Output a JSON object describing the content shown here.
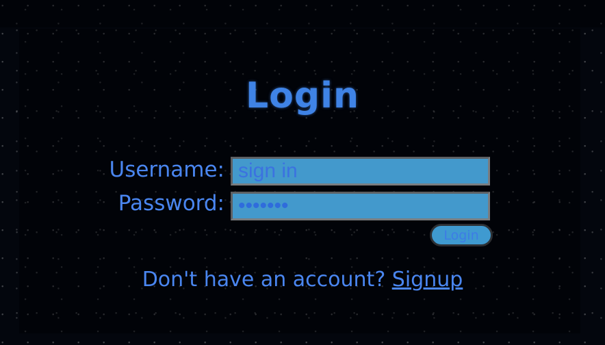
{
  "page": {
    "title": "Login"
  },
  "form": {
    "username_label": "Username:",
    "username_placeholder": "sign in",
    "username_value": "",
    "password_label": "Password:",
    "password_value": "•••••••",
    "login_button": "Login"
  },
  "footer": {
    "prompt": "Don't have an account?",
    "signup_link": "Signup"
  },
  "colors": {
    "text_accent": "#4a86f0",
    "field_background": "#4399cc",
    "page_background": "#03060d"
  }
}
